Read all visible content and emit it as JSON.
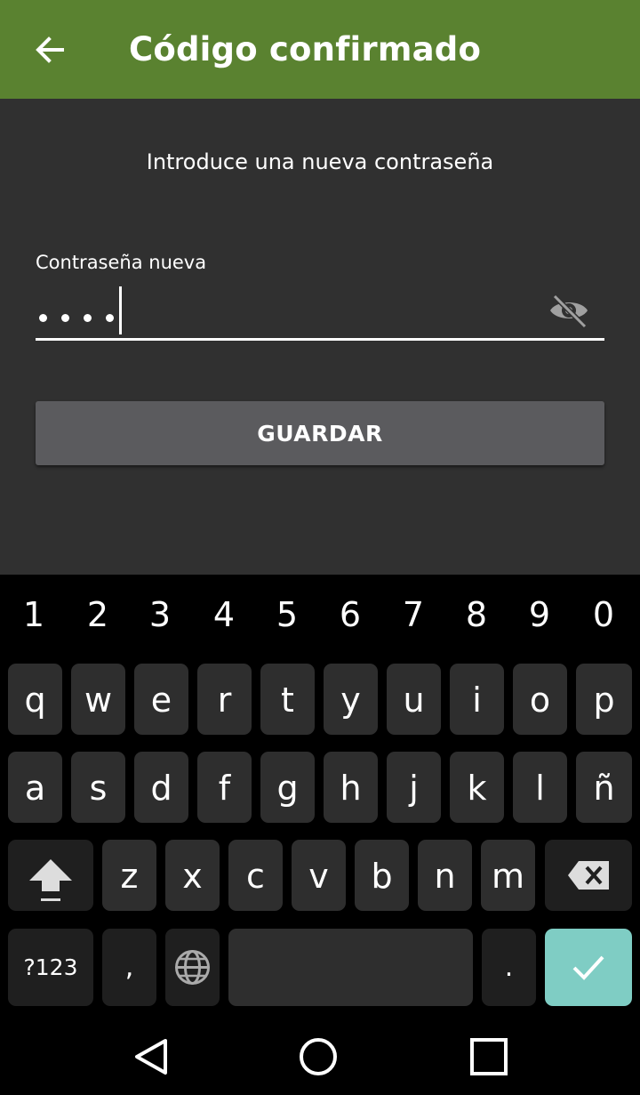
{
  "appbar": {
    "title": "Código confirmado",
    "back_icon": "arrow-left-icon"
  },
  "content": {
    "instruction": "Introduce una nueva contraseña",
    "field_label": "Contraseña nueva",
    "password_mask_count": 4,
    "visibility_icon": "eye-off-icon",
    "save_label": "GUARDAR"
  },
  "keyboard": {
    "numbers": [
      "1",
      "2",
      "3",
      "4",
      "5",
      "6",
      "7",
      "8",
      "9",
      "0"
    ],
    "row1": [
      "q",
      "w",
      "e",
      "r",
      "t",
      "y",
      "u",
      "i",
      "o",
      "p"
    ],
    "row2": [
      "a",
      "s",
      "d",
      "f",
      "g",
      "h",
      "j",
      "k",
      "l",
      "ñ"
    ],
    "row3": [
      "z",
      "x",
      "c",
      "v",
      "b",
      "n",
      "m"
    ],
    "symbols_label": "?123",
    "comma": ",",
    "period": ".",
    "shift_icon": "shift-icon",
    "backspace_icon": "backspace-icon",
    "globe_icon": "globe-icon",
    "enter_icon": "checkmark-icon",
    "enter_color": "#7fcdc4"
  },
  "navbar": {
    "back": "nav-back-icon",
    "home": "nav-home-icon",
    "recents": "nav-recents-icon"
  }
}
